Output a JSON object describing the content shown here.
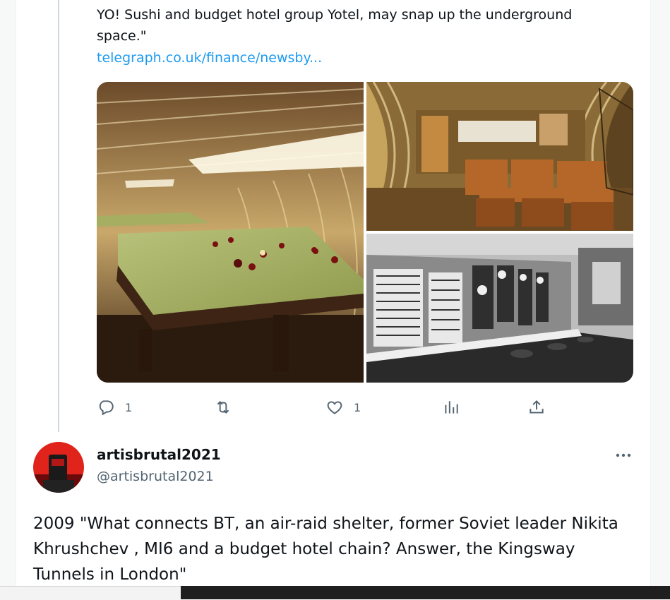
{
  "quoted_tweet": {
    "text_tail": "YO! Sushi and budget hotel group Yotel, may snap up the underground space.\"",
    "link": "telegraph.co.uk/finance/newsby..."
  },
  "media": [
    {
      "name": "snooker-room-image"
    },
    {
      "name": "canteen-image"
    },
    {
      "name": "control-room-image"
    }
  ],
  "actions": {
    "reply": {
      "icon": "reply-icon",
      "count": "1"
    },
    "retweet": {
      "icon": "retweet-icon",
      "count": ""
    },
    "like": {
      "icon": "like-icon",
      "count": "1"
    },
    "views": {
      "icon": "views-icon",
      "count": ""
    },
    "share": {
      "icon": "share-icon"
    }
  },
  "reply_tweet": {
    "display_name": "artisbrutal2021",
    "handle": "@artisbrutal2021",
    "text": "2009 \"What connects BT, an air-raid shelter, former Soviet leader Nikita Khrushchev , MI6 and a budget hotel chain? Answer, the Kingsway Tunnels in London\""
  },
  "colors": {
    "link": "#1d9bf0",
    "secondary_text": "#536471",
    "avatar_bg": "#e0241b"
  }
}
